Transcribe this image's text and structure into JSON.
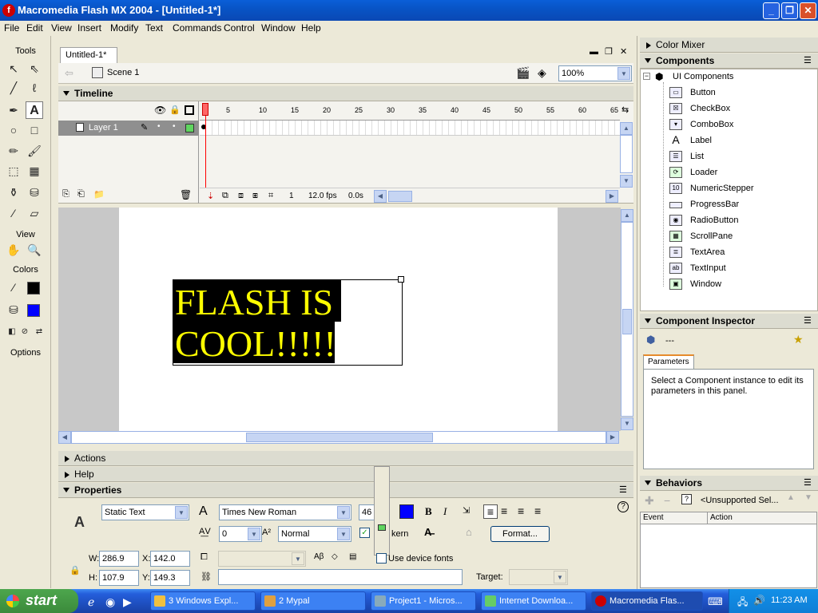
{
  "window": {
    "title": "Macromedia Flash MX 2004 - [Untitled-1*]",
    "app_icon": "flash-logo-icon"
  },
  "menu": [
    "File",
    "Edit",
    "View",
    "Insert",
    "Modify",
    "Text",
    "Commands",
    "Control",
    "Window",
    "Help"
  ],
  "tools": {
    "title": "Tools",
    "view_label": "View",
    "colors_label": "Colors",
    "options_label": "Options"
  },
  "document": {
    "tab": "Untitled-1*",
    "scene": "Scene 1",
    "zoom": "100%",
    "timeline_title": "Timeline",
    "layer_name": "Layer 1",
    "frame_numbers": [
      "1",
      "5",
      "10",
      "15",
      "20",
      "25",
      "30",
      "35",
      "40",
      "45",
      "50",
      "55",
      "60",
      "65"
    ],
    "current_frame": "1",
    "fps": "12.0 fps",
    "elapsed": "0.0s",
    "stage_text_line1": "FLASH IS",
    "stage_text_line2": "COOL!!!!!"
  },
  "collapsed_panels": {
    "actions": "Actions",
    "help": "Help"
  },
  "properties": {
    "title": "Properties",
    "text_type": "Static Text",
    "font": "Times New Roman",
    "font_size": "46",
    "letter_spacing": "0",
    "baseline": "Normal",
    "autokern": "kern",
    "format_button": "Format...",
    "use_device_fonts": "Use device fonts",
    "w_label": "W:",
    "w": "286.9",
    "h_label": "H:",
    "h": "107.9",
    "x_label": "X:",
    "x": "142.0",
    "y_label": "Y:",
    "y": "149.3",
    "target_label": "Target:",
    "bold": "B",
    "italic": "I",
    "text_color": "#0000ff"
  },
  "right_panels": {
    "color_mixer": "Color Mixer",
    "components": "Components",
    "ui_components": "UI Components",
    "component_list": [
      "Button",
      "CheckBox",
      "ComboBox",
      "Label",
      "List",
      "Loader",
      "NumericStepper",
      "ProgressBar",
      "RadioButton",
      "ScrollPane",
      "TextArea",
      "TextInput",
      "Window"
    ],
    "component_inspector": "Component Inspector",
    "inspector_dash": "---",
    "parameters_tab": "Parameters",
    "inspector_message": "Select a Component instance to edit its parameters in this panel.",
    "behaviors": "Behaviors",
    "unsupported": "<Unsupported Sel...",
    "col_event": "Event",
    "col_action": "Action"
  },
  "taskbar": {
    "start": "start",
    "items": [
      "3 Windows Expl...",
      "2 Mypal",
      "Project1 - Micros...",
      "Internet Downloa...",
      "Macromedia Flas..."
    ],
    "clock": "11:23 AM"
  },
  "colors": {
    "stage_text": "#ffff00",
    "stage_text_bg": "#000000",
    "titlebar": "#0a5fd8"
  }
}
